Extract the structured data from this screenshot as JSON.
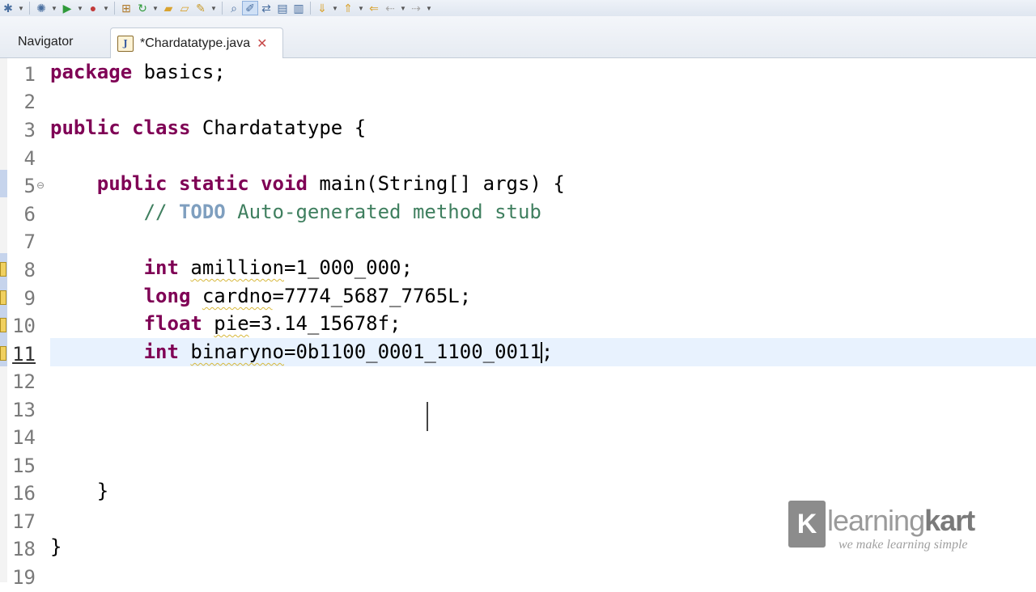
{
  "toolbar": {
    "icons": [
      "bug-icon",
      "run-icon",
      "external-tools-icon",
      "new-package-icon",
      "refresh-icon",
      "open-folder-icon",
      "open-file-icon",
      "pencil-icon",
      "search-icon",
      "highlight-icon",
      "toggle-icon",
      "outline-icon",
      "pin-icon",
      "next-annotation-icon",
      "previous-annotation-icon",
      "last-edit-icon",
      "back-icon",
      "forward-icon"
    ]
  },
  "tabs": {
    "navigator": "Navigator",
    "editor": "*Chardatatype.java"
  },
  "editor": {
    "lines": [
      {
        "n": "1",
        "text": "package basics;"
      },
      {
        "n": "2",
        "text": ""
      },
      {
        "n": "3",
        "text": "public class Chardatatype {"
      },
      {
        "n": "4",
        "text": ""
      },
      {
        "n": "5",
        "text": "    public static void main(String[] args) {"
      },
      {
        "n": "6",
        "text": "        // TODO Auto-generated method stub"
      },
      {
        "n": "7",
        "text": ""
      },
      {
        "n": "8",
        "text": "        int amillion=1_000_000;"
      },
      {
        "n": "9",
        "text": "        long cardno=7774_5687_7765L;"
      },
      {
        "n": "10",
        "text": "        float pie=3.14_15678f;"
      },
      {
        "n": "11",
        "text": "        int binaryno=0b1100_0001_1100_0011;"
      },
      {
        "n": "12",
        "text": ""
      },
      {
        "n": "13",
        "text": ""
      },
      {
        "n": "14",
        "text": ""
      },
      {
        "n": "15",
        "text": ""
      },
      {
        "n": "16",
        "text": "    }"
      },
      {
        "n": "17",
        "text": ""
      },
      {
        "n": "18",
        "text": "}"
      },
      {
        "n": "19",
        "text": ""
      }
    ],
    "current_line": "11"
  },
  "logo": {
    "mark": "K",
    "name_light": "learning",
    "name_bold": "kart",
    "tagline": "we make learning simple"
  },
  "colors": {
    "keyword": "#7f0055",
    "comment": "#3f7f5f",
    "todo": "#7f9fbf",
    "current_line": "#e8f2fe"
  }
}
